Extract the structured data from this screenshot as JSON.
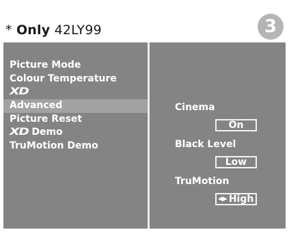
{
  "note": {
    "prefix": "* ",
    "only": "Only",
    "model": " 42LY99"
  },
  "step_number": "3",
  "picture_menu": {
    "items": [
      {
        "label": "Picture Mode",
        "logo": "",
        "active": false
      },
      {
        "label": "Colour Temperature",
        "logo": "",
        "active": false
      },
      {
        "label": "",
        "logo": "XD",
        "active": false
      },
      {
        "label": "Advanced",
        "logo": "",
        "active": true
      },
      {
        "label": "Picture Reset",
        "logo": "",
        "active": false
      },
      {
        "label": "Demo",
        "logo": "XD",
        "active": false
      },
      {
        "label": "TruMotion Demo",
        "logo": "",
        "active": false
      }
    ]
  },
  "advanced_settings": {
    "cinema": {
      "label": "Cinema",
      "value": "On"
    },
    "black_level": {
      "label": "Black Level",
      "value": "Low"
    },
    "trumotion": {
      "label": "TruMotion",
      "value": "High",
      "arrows": true
    }
  },
  "colors": {
    "osd_background": "#848484",
    "selected_row": "#a2a2a2",
    "badge": "#b5b5b5"
  }
}
